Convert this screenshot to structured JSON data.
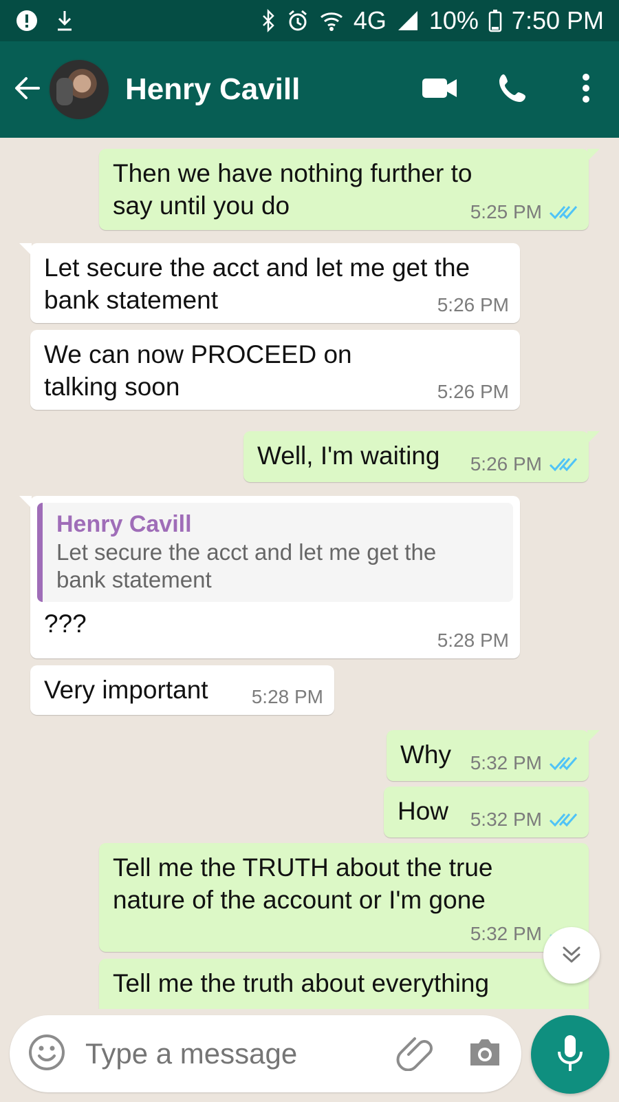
{
  "status_bar": {
    "left_icons": [
      "alert-circle-icon",
      "download-icon"
    ],
    "right_icons": [
      "bluetooth-icon",
      "alarm-icon",
      "wifi-icon",
      "4g-signal-icon",
      "battery-icon"
    ],
    "network": "4G",
    "battery": "10%",
    "time": "7:50 PM"
  },
  "header": {
    "back_icon": "back-arrow-icon",
    "contact_name": "Henry Cavill",
    "video_call_icon": "video-call-icon",
    "phone_call_icon": "phone-call-icon",
    "menu_icon": "more-vertical-icon"
  },
  "chat": {
    "messages": [
      {
        "direction": "out",
        "text": "Then we have nothing further to\nsay until you do",
        "time": "5:25 PM",
        "status": "read"
      },
      {
        "direction": "in",
        "text": "Let secure the acct and let me get the\nbank statement",
        "time": "5:26 PM"
      },
      {
        "direction": "in",
        "text": "We can now PROCEED on\ntalking soon",
        "time": "5:26 PM"
      },
      {
        "direction": "out",
        "text": "Well, I'm waiting",
        "time": "5:26 PM",
        "status": "read"
      },
      {
        "direction": "in",
        "quote": {
          "author": "Henry Cavill",
          "text": "Let secure the acct and let me get the\nbank statement"
        },
        "text": "???",
        "time": "5:28 PM"
      },
      {
        "direction": "in",
        "text": "Very important",
        "time": "5:28 PM"
      },
      {
        "direction": "out",
        "text": "Why",
        "time": "5:32 PM",
        "status": "read"
      },
      {
        "direction": "out",
        "text": "How",
        "time": "5:32 PM",
        "status": "read"
      },
      {
        "direction": "out",
        "text": "Tell me the TRUTH about the true\nnature of the account or I'm gone",
        "time": "5:32 PM",
        "status": "read"
      },
      {
        "direction": "out",
        "text": "Tell me the truth about everything",
        "time": "",
        "status": ""
      }
    ],
    "scroll_to_bottom_icon": "double-chevron-down-icon"
  },
  "composer": {
    "emoji_icon": "emoji-icon",
    "placeholder": "Type a message",
    "attach_icon": "paperclip-icon",
    "camera_icon": "camera-icon",
    "mic_icon": "microphone-icon"
  },
  "colors": {
    "status_bar": "#054d44",
    "header": "#075e54",
    "outgoing_bubble": "#dcf8c6",
    "incoming_bubble": "#ffffff",
    "chat_background": "#ece5dd",
    "read_tick": "#4fc3f7",
    "quote_accent": "#9f6db8",
    "mic_button": "#0f8f7f"
  }
}
